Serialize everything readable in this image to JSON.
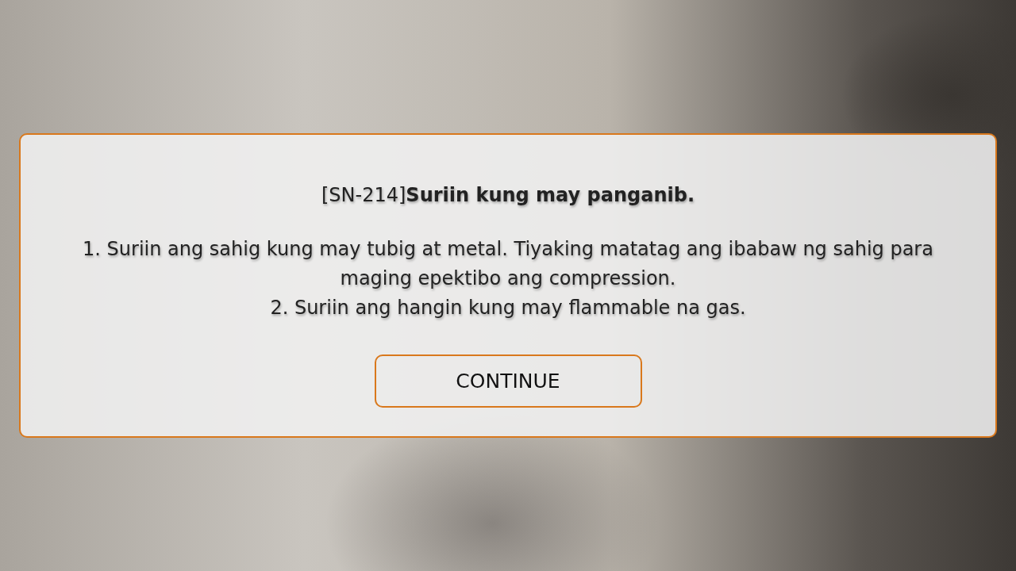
{
  "dialog": {
    "title": "[SN-214]**Suriin kung may panganib.**",
    "lines": [
      "1. Suriin ang sahig kung may tubig at metal. Tiyaking matatag ang ibabaw ng sahig para maging epektibo ang compression.",
      "2. Suriin ang hangin kung may flammable na gas."
    ],
    "button": "CONTINUE"
  }
}
